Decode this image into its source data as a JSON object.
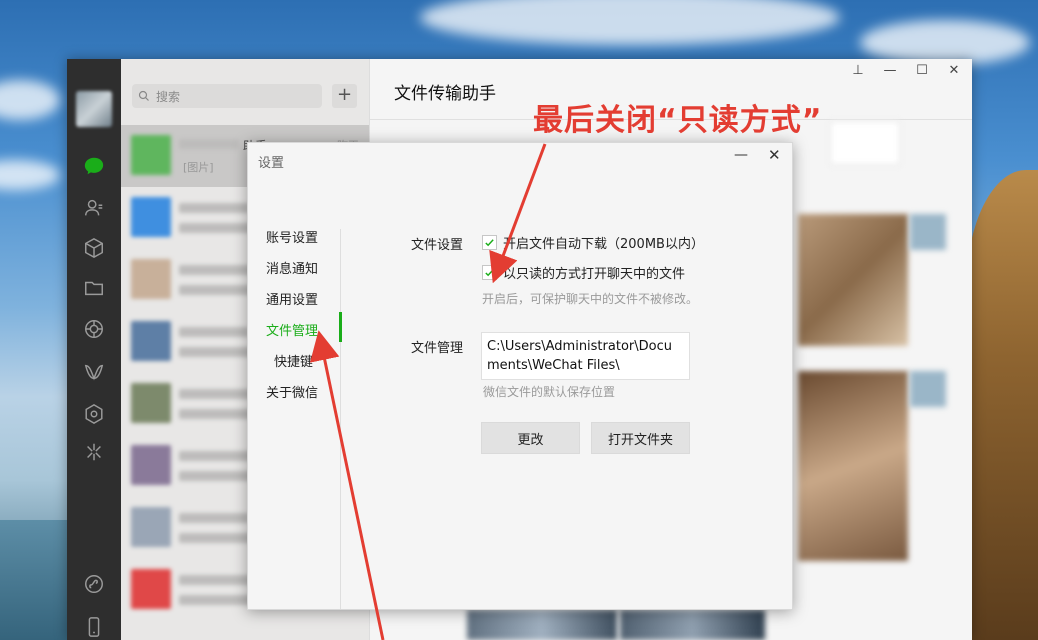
{
  "wechat": {
    "search_placeholder": "搜索",
    "plus_label": "+",
    "chat_title": "文件传输助手",
    "active_chat": {
      "name": "助手",
      "time": "昨天",
      "preview": "[图片]"
    },
    "window_controls": {
      "pin": "⊥",
      "minimize": "—",
      "maximize": "☐",
      "close": "✕"
    }
  },
  "dialog": {
    "title": "设置",
    "minimize": "—",
    "close": "✕",
    "nav": [
      "账号设置",
      "消息通知",
      "通用设置",
      "文件管理",
      "快捷键",
      "关于微信"
    ],
    "active_nav": "文件管理",
    "file_settings_label": "文件设置",
    "auto_download_label": "开启文件自动下载（200MB以内）",
    "readonly_label": "以只读的方式打开聊天中的文件",
    "readonly_hint": "开启后，可保护聊天中的文件不被修改。",
    "file_manage_label": "文件管理",
    "save_path": "C:\\Users\\Administrator\\Documents\\WeChat Files\\",
    "path_hint": "微信文件的默认保存位置",
    "change_button": "更改",
    "open_folder_button": "打开文件夹"
  },
  "annotation": {
    "text": "最后关闭“只读方式”",
    "color": "#e33d32"
  },
  "colors": {
    "accent": "#1aad19",
    "rail": "#2e2e2e"
  }
}
